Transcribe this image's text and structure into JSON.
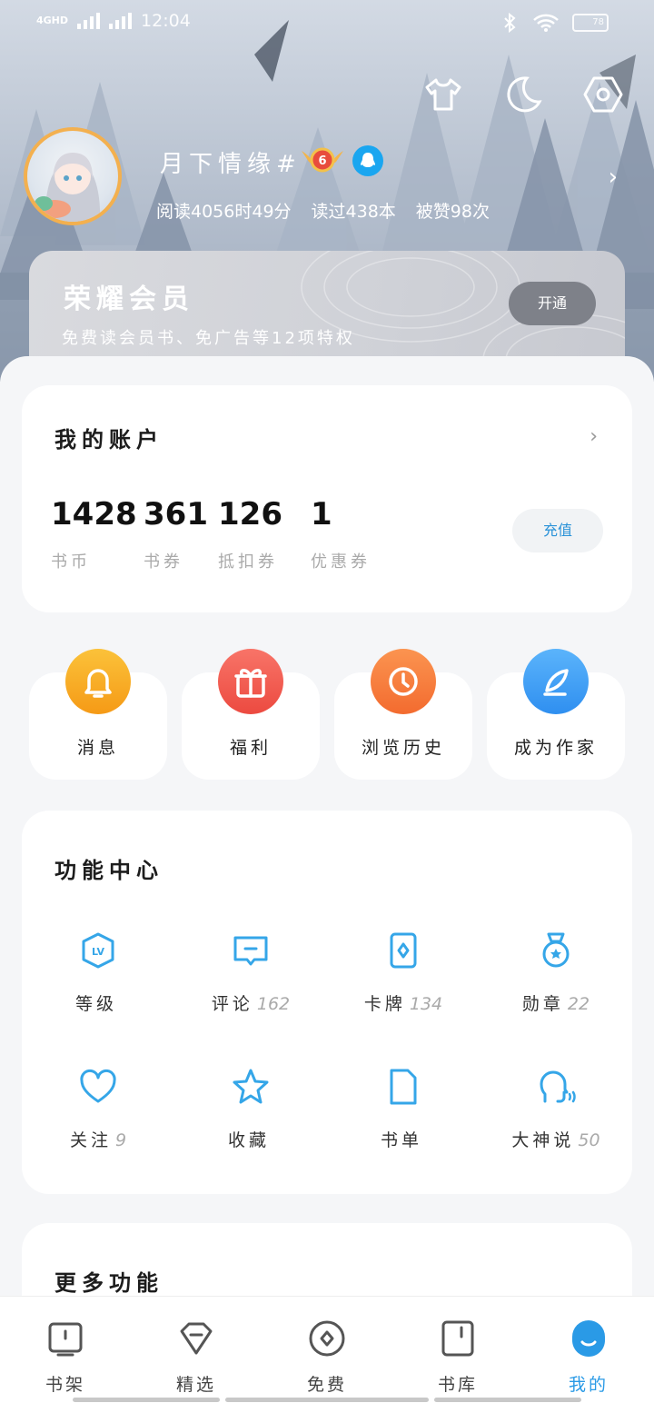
{
  "status_bar": {
    "network": "4GHD",
    "time": "12:04",
    "battery": "78"
  },
  "header_icons": [
    "tshirt-icon",
    "moon-icon",
    "settings-hexagon-icon"
  ],
  "profile": {
    "username": "月下情缘#",
    "level": "6",
    "stats": {
      "read_time": "阅读4056时49分",
      "books_read": "读过438本",
      "likes": "被赞98次"
    }
  },
  "vip": {
    "title": "荣耀会员",
    "subtitle": "免费读会员书、免广告等12项特权",
    "button": "开通"
  },
  "account": {
    "title": "我的账户",
    "items": [
      {
        "value": "1428",
        "label": "书币"
      },
      {
        "value": "361",
        "label": "书券"
      },
      {
        "value": "126",
        "label": "抵扣券"
      },
      {
        "value": "1",
        "label": "优惠券"
      }
    ],
    "recharge": "充值"
  },
  "quick_actions": [
    {
      "label": "消息",
      "icon": "bell-icon",
      "color": "#f7a21b"
    },
    {
      "label": "福利",
      "icon": "gift-icon",
      "color": "#f05a4f"
    },
    {
      "label": "浏览历史",
      "icon": "clock-icon",
      "color": "#f7773a"
    },
    {
      "label": "成为作家",
      "icon": "feather-icon",
      "color": "#3e9df2"
    }
  ],
  "function_center": {
    "title": "功能中心",
    "items": [
      {
        "label": "等级",
        "count": "",
        "icon": "level-badge-icon"
      },
      {
        "label": "评论",
        "count": "162",
        "icon": "comment-icon"
      },
      {
        "label": "卡牌",
        "count": "134",
        "icon": "card-icon"
      },
      {
        "label": "勋章",
        "count": "22",
        "icon": "medal-icon"
      },
      {
        "label": "关注",
        "count": "9",
        "icon": "heart-icon"
      },
      {
        "label": "收藏",
        "count": "",
        "icon": "star-icon"
      },
      {
        "label": "书单",
        "count": "",
        "icon": "booklist-icon"
      },
      {
        "label": "大神说",
        "count": "50",
        "icon": "speaker-head-icon"
      }
    ]
  },
  "more": {
    "title": "更多功能"
  },
  "tabs": [
    {
      "label": "书架",
      "icon": "bookshelf-icon",
      "active": false
    },
    {
      "label": "精选",
      "icon": "diamond-icon",
      "active": false
    },
    {
      "label": "免费",
      "icon": "free-circle-icon",
      "active": false
    },
    {
      "label": "书库",
      "icon": "library-icon",
      "active": false
    },
    {
      "label": "我的",
      "icon": "profile-face-icon",
      "active": true
    }
  ],
  "accent_color": "#2a9ae6",
  "icon_color": "#35a6e8"
}
